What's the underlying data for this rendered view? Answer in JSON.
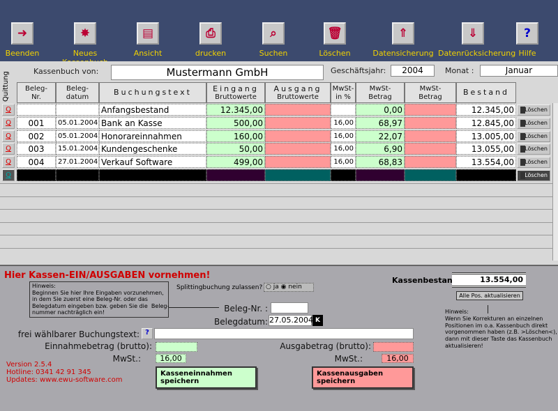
{
  "toolbar": [
    {
      "label": "Beenden",
      "icon": "exit-door-icon"
    },
    {
      "label": "Neues Kassenbuch",
      "icon": "new-book-icon"
    },
    {
      "label": "Ansicht",
      "icon": "view-icon"
    },
    {
      "label": "drucken",
      "icon": "print-icon"
    },
    {
      "label": "Suchen",
      "icon": "search-icon"
    },
    {
      "label": "Löschen",
      "icon": "delete-icon"
    },
    {
      "label": "Datensicherung",
      "icon": "backup-icon"
    },
    {
      "label": "Datenrücksicherung",
      "icon": "restore-icon"
    },
    {
      "label": "Hilfe",
      "icon": "help-icon"
    }
  ],
  "header": {
    "owner_label": "Kassenbuch von:",
    "owner": "Mustermann GmbH",
    "year_label": "Geschäftsjahr:",
    "year": "2004",
    "month_label": "Monat :",
    "month": "Januar",
    "quittung": "Quittung"
  },
  "columns": [
    "Beleg-\nNr.",
    "Beleg-\ndatum",
    "Buchungstext",
    "Eingang",
    "Ausgang",
    "MwSt-\nin %",
    "MwSt-\nBetrag",
    "MwSt-\nBetrag",
    "Bestand"
  ],
  "column_sub": {
    "eingang": "Bruttowerte",
    "ausgang": "Bruttowerte"
  },
  "rows": [
    {
      "nr": "",
      "datum": "",
      "text": "Anfangsbestand",
      "eingang": "12.345,00",
      "ausgang": "",
      "mwst": "",
      "mwst_betrag_ein": "0,00",
      "mwst_betrag_aus": "",
      "bestand": "12.345,00"
    },
    {
      "nr": "001",
      "datum": "05.01.2004",
      "text": "Bank an Kasse",
      "eingang": "500,00",
      "ausgang": "",
      "mwst": "16,00",
      "mwst_betrag_ein": "68,97",
      "mwst_betrag_aus": "",
      "bestand": "12.845,00"
    },
    {
      "nr": "002",
      "datum": "05.01.2004",
      "text": "Honorareinnahmen",
      "eingang": "160,00",
      "ausgang": "",
      "mwst": "16,00",
      "mwst_betrag_ein": "22,07",
      "mwst_betrag_aus": "",
      "bestand": "13.005,00"
    },
    {
      "nr": "003",
      "datum": "15.01.2004",
      "text": "Kundengeschenke",
      "eingang": "50,00",
      "ausgang": "",
      "mwst": "16,00",
      "mwst_betrag_ein": "6,90",
      "mwst_betrag_aus": "",
      "bestand": "13.055,00"
    },
    {
      "nr": "004",
      "datum": "27.01.2004",
      "text": "Verkauf Software",
      "eingang": "499,00",
      "ausgang": "",
      "mwst": "16,00",
      "mwst_betrag_ein": "68,83",
      "mwst_betrag_aus": "",
      "bestand": "13.554,00"
    }
  ],
  "row_q": "Q",
  "row_delete": "Löschen",
  "form": {
    "title": "Hier Kassen-EIN/AUSGABEN vornehmen!",
    "hint": "Hinweis:\nBeginnen Sie hier Ihre Eingaben vorzunehmen,\nin dem Sie zuerst eine Beleg-Nr. oder das\nBelegdatum eingeben bzw. geben Sie die  Beleg-\nnummer nachträglich ein!",
    "split_label": "Splittingbuchung zulassen?",
    "split_ja": "ja",
    "split_nein": "nein",
    "belegnr_label": "Beleg-Nr. :",
    "belegnr": "",
    "belegdatum_label": "Belegdatum:",
    "belegdatum": "27.05.2004",
    "k_btn": "K",
    "text_label": "frei wählbarer Buchungstext:",
    "help_btn": "?",
    "text": "",
    "einnahme_label": "Einnahmebetrag (brutto):",
    "einnahme": "",
    "ausgabe_label": "Ausgabetrag (brutto):",
    "ausgabe": "",
    "mwst_label": "MwSt.:",
    "mwst_ein": "16,00",
    "mwst_aus": "16,00",
    "save_in": "Kasseneinnahmen speichern",
    "save_out": "Kassenausgaben speichern",
    "kassenbestand_label": "Kassenbestand:",
    "kassenbestand": "13.554,00",
    "refresh_btn": "Alle Pos. aktualisieren",
    "hint2": "Hinweis:\nWenn Sie Korrekturen an einzelnen\nPositionen im o.a. Kassenbuch direkt\nvorgenommen haben (z.B. >Löschen<),\ndann mit dieser Taste das Kassenbuch\naktualisieren!",
    "version": "Version 2.5.4",
    "hotline": "Hotline: 0341 42 91 345",
    "updates": "Updates: www.ewu-software.com"
  },
  "colors": {
    "green": "#ccffcc",
    "red": "#ff9999",
    "navy": "#3c4a6e",
    "yellow": "#f2d200"
  }
}
